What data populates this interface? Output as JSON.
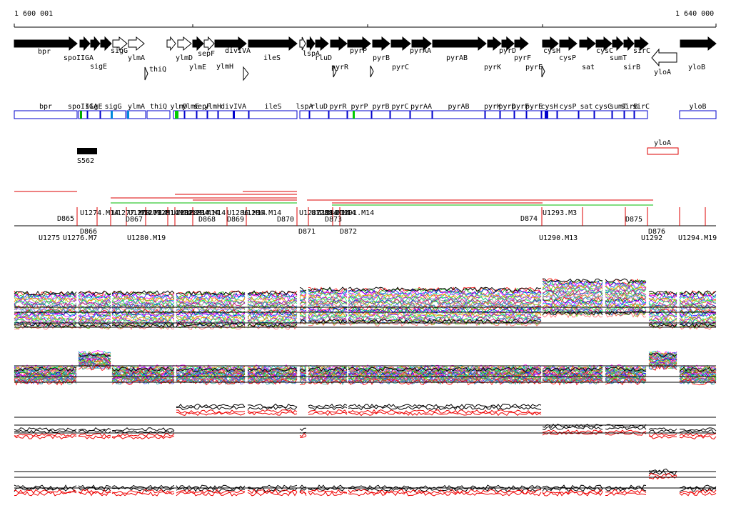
{
  "ruler": {
    "start": "1 600 001",
    "end": "1 640 000"
  },
  "genes_forward": [
    {
      "name": "bpr",
      "dir": "+",
      "filled": true
    },
    {
      "name": "spoIIGA",
      "dir": "+",
      "filled": true
    },
    {
      "name": "sigE",
      "dir": "+",
      "filled": true
    },
    {
      "name": "sigG",
      "dir": "+",
      "filled": true
    },
    {
      "name": "ylmA",
      "dir": "+",
      "filled": false
    },
    {
      "name": "thiQ",
      "dir": "+",
      "filled": false
    },
    {
      "name": "ylmD",
      "dir": "+",
      "filled": false
    },
    {
      "name": "ylmE",
      "dir": "+",
      "filled": false
    },
    {
      "name": "sepF",
      "dir": "+",
      "filled": true
    },
    {
      "name": "ylmH",
      "dir": "+",
      "filled": false
    },
    {
      "name": "divIVA",
      "dir": "+",
      "filled": true
    },
    {
      "name": "ileS",
      "dir": "+",
      "filled": true
    },
    {
      "name": "lspA",
      "dir": "+",
      "filled": false
    },
    {
      "name": "rluD",
      "dir": "+",
      "filled": true
    },
    {
      "name": "pyrR",
      "dir": "+",
      "filled": true
    },
    {
      "name": "pyrP",
      "dir": "+",
      "filled": true
    },
    {
      "name": "pyrB",
      "dir": "+",
      "filled": true
    },
    {
      "name": "pyrC",
      "dir": "+",
      "filled": true
    },
    {
      "name": "pyrAA",
      "dir": "+",
      "filled": true
    },
    {
      "name": "pyrAB",
      "dir": "+",
      "filled": true
    },
    {
      "name": "pyrK",
      "dir": "+",
      "filled": true
    },
    {
      "name": "pyrD",
      "dir": "+",
      "filled": true
    },
    {
      "name": "pyrF",
      "dir": "+",
      "filled": true
    },
    {
      "name": "pyrE",
      "dir": "+",
      "filled": true
    },
    {
      "name": "cysH",
      "dir": "+",
      "filled": true
    },
    {
      "name": "cysP",
      "dir": "+",
      "filled": true
    },
    {
      "name": "sat",
      "dir": "+",
      "filled": true
    },
    {
      "name": "cysC",
      "dir": "+",
      "filled": true
    },
    {
      "name": "sirB",
      "dir": "+",
      "filled": true
    },
    {
      "name": "sumT",
      "dir": "+",
      "filled": true
    },
    {
      "name": "sirC",
      "dir": "+",
      "filled": true
    },
    {
      "name": "yloA",
      "dir": "-",
      "filled": false
    },
    {
      "name": "yloB",
      "dir": "+",
      "filled": true
    }
  ],
  "annotation_bar": [
    "bpr",
    "spoIIGA",
    "sigE",
    "sigG",
    "ylmA",
    "thiQ",
    "ylmD",
    "ylmE",
    "sepF",
    "ylmH",
    "divIVA",
    "ileS",
    "lspA",
    "rluD",
    "pyrR",
    "pyrP",
    "pyrB",
    "pyrC",
    "pyrAA",
    "pyrAB",
    "pyrK",
    "pyrD",
    "pyrF",
    "pyrE",
    "cysH",
    "cysP",
    "sat",
    "cysC",
    "sumT",
    "sirB",
    "sirC",
    "yloB"
  ],
  "features": {
    "s_label": "S562",
    "reverse_label": "yloA"
  },
  "probes_upper": [
    "U1274.M14",
    "U1277.M14",
    "U1278.M14",
    "U1279.M14",
    "U1281.M14",
    "U1282.M14",
    "U1283.M14",
    "U1284.M14",
    "U1286.M14",
    "U1286.M14",
    "U1287.M14",
    "U1288.M14",
    "U1289.M14",
    "U1291.M14",
    "U1293.M3"
  ],
  "probes_lower": [
    "U1275",
    "U1276.M7",
    "U1280.M19",
    "U1290.M13",
    "U1292",
    "U1294.M19"
  ],
  "d_labels": [
    "D865",
    "D866",
    "D867",
    "D868",
    "D869",
    "D870",
    "D871",
    "D872",
    "D873",
    "D874",
    "D875",
    "D876"
  ],
  "track_colors": {
    "gene_fill": "#000000",
    "annotation_box": "#0000cc",
    "probe_red": "#dd0000",
    "probe_green": "#00bb00",
    "feature_red": "#dd0000",
    "profile_black": "#000000",
    "profile_red": "#ee0000"
  }
}
